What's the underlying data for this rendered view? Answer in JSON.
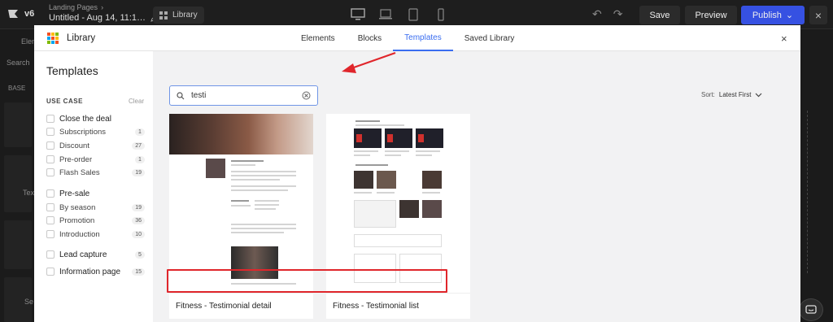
{
  "editor": {
    "version_badge": "v6",
    "breadcrumb": "Landing Pages",
    "page_title": "Untitled - Aug 14, 11:1…",
    "library_button": "Library",
    "save": "Save",
    "preview": "Preview",
    "publish": "Publish",
    "left_panel": {
      "tab": "Eleme",
      "search_placeholder": "Search",
      "section": "BASE",
      "partial_1": "Tex",
      "partial_2": "Se"
    }
  },
  "modal": {
    "title": "Library",
    "tabs": [
      {
        "label": "Elements",
        "active": false
      },
      {
        "label": "Blocks",
        "active": false
      },
      {
        "label": "Templates",
        "active": true
      },
      {
        "label": "Saved Library",
        "active": false
      }
    ],
    "close": "×"
  },
  "sidebar": {
    "title": "Templates",
    "use_case_label": "USE CASE",
    "clear_label": "Clear",
    "filters": [
      {
        "label": "Close the deal",
        "group": true,
        "count": ""
      },
      {
        "label": "Subscriptions",
        "group": false,
        "count": "1"
      },
      {
        "label": "Discount",
        "group": false,
        "count": "27"
      },
      {
        "label": "Pre-order",
        "group": false,
        "count": "1"
      },
      {
        "label": "Flash Sales",
        "group": false,
        "count": "19"
      },
      {
        "label": "Pre-sale",
        "group": true,
        "count": ""
      },
      {
        "label": "By season",
        "group": false,
        "count": "19"
      },
      {
        "label": "Promotion",
        "group": false,
        "count": "36"
      },
      {
        "label": "Introduction",
        "group": false,
        "count": "10"
      },
      {
        "label": "Lead capture",
        "group": true,
        "count": "5"
      },
      {
        "label": "Information page",
        "group": true,
        "count": "15"
      }
    ]
  },
  "search": {
    "value": "testi"
  },
  "sort": {
    "label": "Sort:",
    "value": "Latest First"
  },
  "templates": [
    {
      "name": "Fitness - Testimonial detail"
    },
    {
      "name": "Fitness - Testimonial list"
    }
  ],
  "colors": {
    "accent": "#3a6df0",
    "annotation": "#e0262b",
    "publish": "#3651e2"
  }
}
